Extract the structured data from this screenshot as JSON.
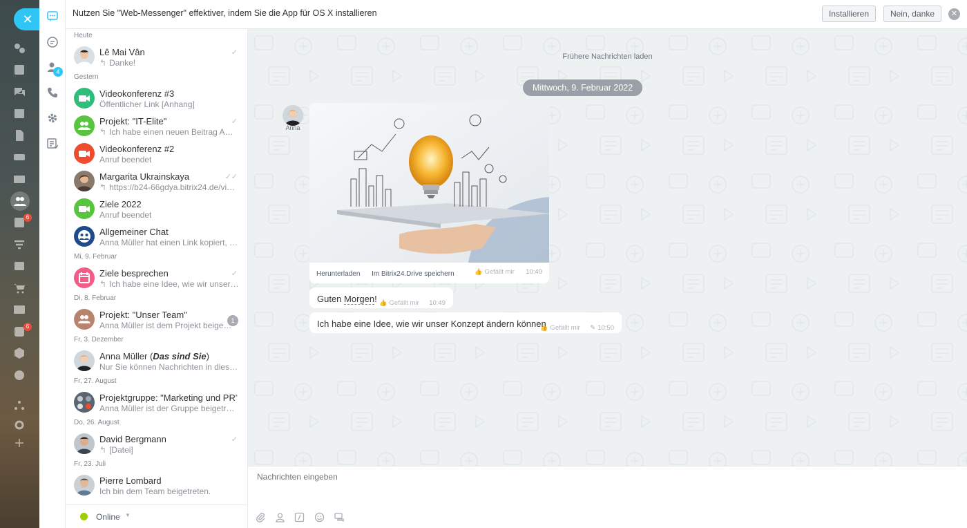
{
  "banner": {
    "text": "Nutzen Sie \"Web-Messenger\" effektiver, indem Sie die App für OS X installieren",
    "install_label": "Installieren",
    "decline_label": "Nein, danke"
  },
  "left_strip": {
    "close_label": "✕",
    "badges": [
      "6",
      "6"
    ]
  },
  "rail": {
    "contacts_badge": "4"
  },
  "recent": {
    "sections": [
      {
        "date": "Heute"
      },
      {
        "date": "Gestern"
      },
      {
        "date": "Mi, 9. Februar"
      },
      {
        "date": "Di, 8. Februar"
      },
      {
        "date": "Fr, 3. Dezember"
      },
      {
        "date": "Fr, 27. August"
      },
      {
        "date": "Do, 26. August"
      },
      {
        "date": "Fr, 23. Juli"
      }
    ],
    "items": [
      {
        "title": "Lê Mai Vân",
        "sub": "Danke!"
      },
      {
        "title": "Videokonferenz #3",
        "sub": "Öffentlicher Link [Anhang]"
      },
      {
        "title": "Projekt: \"IT-Elite\"",
        "sub": "Ich habe einen neuen Beitrag Am …"
      },
      {
        "title": "Videokonferenz #2",
        "sub": "Anruf beendet"
      },
      {
        "title": "Margarita Ukrainskaya",
        "sub": "https://b24-66gdya.bitrix24.de/vid…"
      },
      {
        "title": "Ziele 2022",
        "sub": "Anruf beendet"
      },
      {
        "title": "Allgemeiner Chat",
        "sub": "Anna Müller hat einen Link kopiert, u…"
      },
      {
        "title": "Ziele besprechen",
        "sub": "Ich habe eine Idee, wie wir unser …"
      },
      {
        "title": "Projekt: \"Unser Team\"",
        "sub": "Anna Müller ist dem Projekt beige…",
        "counter": "1"
      },
      {
        "title_main": "Anna Müller (",
        "title_em": "Das sind Sie",
        "title_end": ")",
        "sub": "Nur Sie können Nachrichten in diese…"
      },
      {
        "title": "Projektgruppe: \"Marketing und PR\"",
        "sub": "Anna Müller ist der Gruppe beigetreten"
      },
      {
        "title": "David Bergmann",
        "sub": "[Datei]"
      },
      {
        "title": "Pierre Lombard",
        "sub": "Ich bin dem Team beigetreten."
      }
    ],
    "status": "Online"
  },
  "chat": {
    "load_more": "Frühere Nachrichten laden",
    "date": "Mittwoch, 9. Februar 2022",
    "author": "Anna",
    "image_message": {
      "download": "Herunterladen",
      "save": "Im Bitrix24.Drive speichern",
      "like": "Gefällt mir",
      "time": "10:49"
    },
    "messages": [
      {
        "text_a": "Guten ",
        "text_b": "Morgen",
        "text_c": "!",
        "like": "Gefällt mir",
        "time": "10:49"
      },
      {
        "text": "Ich habe eine Idee, wie wir unser Konzept ändern können",
        "like": "Gefällt mir",
        "time": "10:50"
      }
    ]
  },
  "composer": {
    "placeholder": "Nachrichten eingeben"
  }
}
